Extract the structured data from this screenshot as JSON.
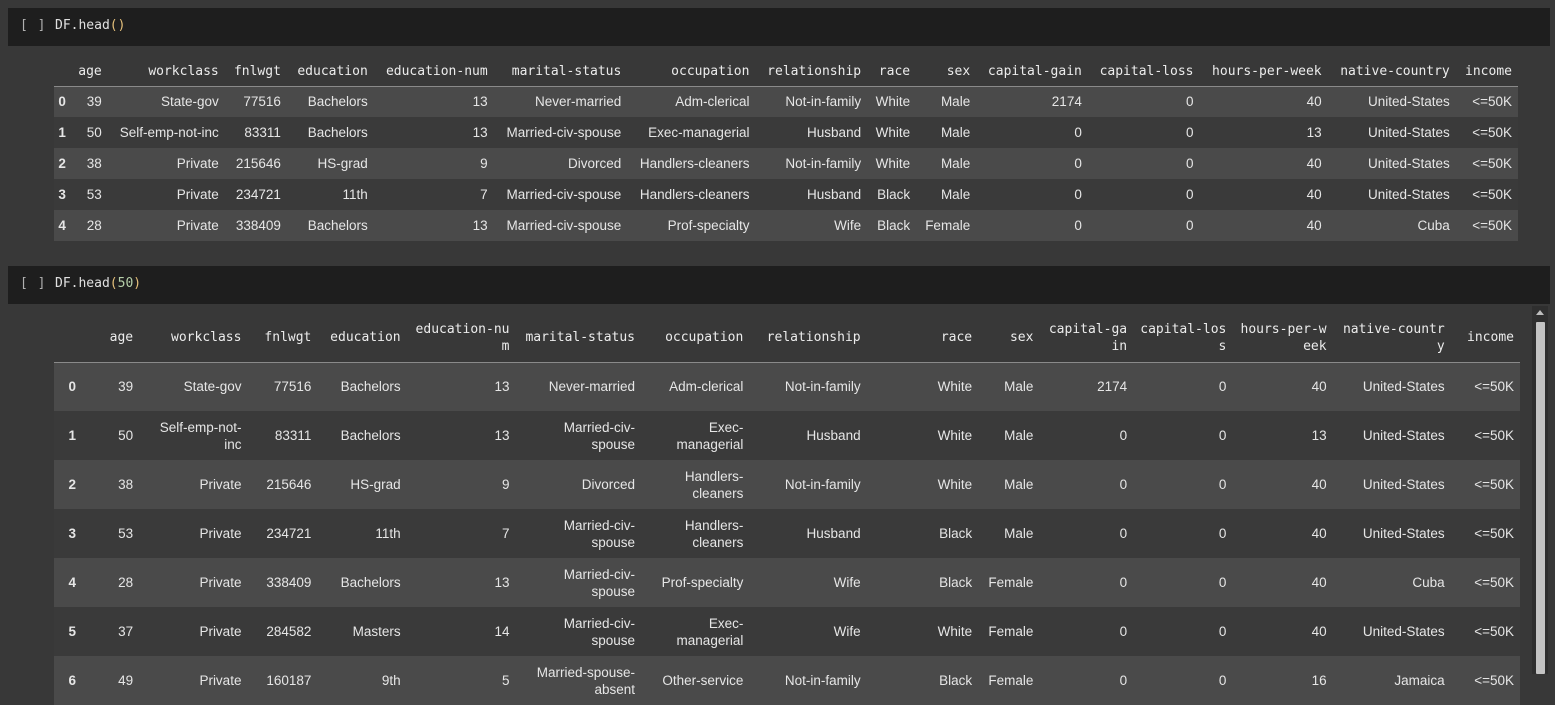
{
  "cells": [
    {
      "run_label": "[ ]",
      "code_prefix": "DF.head",
      "code_open": "(",
      "code_arg": "",
      "code_close": ")"
    },
    {
      "run_label": "[ ]",
      "code_prefix": "DF.head",
      "code_open": "(",
      "code_arg": "50",
      "code_close": ")"
    }
  ],
  "table1": {
    "headers": [
      "",
      "age",
      "workclass",
      "fnlwgt",
      "education",
      "education-num",
      "marital-status",
      "occupation",
      "relationship",
      "race",
      "sex",
      "capital-gain",
      "capital-loss",
      "hours-per-week",
      "native-country",
      "income"
    ],
    "rows": [
      [
        "0",
        "39",
        "State-gov",
        "77516",
        "Bachelors",
        "13",
        "Never-married",
        "Adm-clerical",
        "Not-in-family",
        "White",
        "Male",
        "2174",
        "0",
        "40",
        "United-States",
        "<=50K"
      ],
      [
        "1",
        "50",
        "Self-emp-not-inc",
        "83311",
        "Bachelors",
        "13",
        "Married-civ-spouse",
        "Exec-managerial",
        "Husband",
        "White",
        "Male",
        "0",
        "0",
        "13",
        "United-States",
        "<=50K"
      ],
      [
        "2",
        "38",
        "Private",
        "215646",
        "HS-grad",
        "9",
        "Divorced",
        "Handlers-cleaners",
        "Not-in-family",
        "White",
        "Male",
        "0",
        "0",
        "40",
        "United-States",
        "<=50K"
      ],
      [
        "3",
        "53",
        "Private",
        "234721",
        "11th",
        "7",
        "Married-civ-spouse",
        "Handlers-cleaners",
        "Husband",
        "Black",
        "Male",
        "0",
        "0",
        "40",
        "United-States",
        "<=50K"
      ],
      [
        "4",
        "28",
        "Private",
        "338409",
        "Bachelors",
        "13",
        "Married-civ-spouse",
        "Prof-specialty",
        "Wife",
        "Black",
        "Female",
        "0",
        "0",
        "40",
        "Cuba",
        "<=50K"
      ]
    ]
  },
  "table2": {
    "headers": [
      "",
      "age",
      "workclass",
      "fnlwgt",
      "education",
      "education-num",
      "marital-status",
      "occupation",
      "relationship",
      "race",
      "sex",
      "capital-gain",
      "capital-loss",
      "hours-per-week",
      "native-country",
      "income"
    ],
    "rows": [
      [
        "0",
        "39",
        "State-gov",
        "77516",
        "Bachelors",
        "13",
        "Never-married",
        "Adm-clerical",
        "Not-in-family",
        "White",
        "Male",
        "2174",
        "0",
        "40",
        "United-States",
        "<=50K"
      ],
      [
        "1",
        "50",
        "Self-emp-not-inc",
        "83311",
        "Bachelors",
        "13",
        "Married-civ-spouse",
        "Exec-managerial",
        "Husband",
        "White",
        "Male",
        "0",
        "0",
        "13",
        "United-States",
        "<=50K"
      ],
      [
        "2",
        "38",
        "Private",
        "215646",
        "HS-grad",
        "9",
        "Divorced",
        "Handlers-cleaners",
        "Not-in-family",
        "White",
        "Male",
        "0",
        "0",
        "40",
        "United-States",
        "<=50K"
      ],
      [
        "3",
        "53",
        "Private",
        "234721",
        "11th",
        "7",
        "Married-civ-spouse",
        "Handlers-cleaners",
        "Husband",
        "Black",
        "Male",
        "0",
        "0",
        "40",
        "United-States",
        "<=50K"
      ],
      [
        "4",
        "28",
        "Private",
        "338409",
        "Bachelors",
        "13",
        "Married-civ-spouse",
        "Prof-specialty",
        "Wife",
        "Black",
        "Female",
        "0",
        "0",
        "40",
        "Cuba",
        "<=50K"
      ],
      [
        "5",
        "37",
        "Private",
        "284582",
        "Masters",
        "14",
        "Married-civ-spouse",
        "Exec-managerial",
        "Wife",
        "White",
        "Female",
        "0",
        "0",
        "40",
        "United-States",
        "<=50K"
      ],
      [
        "6",
        "49",
        "Private",
        "160187",
        "9th",
        "5",
        "Married-spouse-absent",
        "Other-service",
        "Not-in-family",
        "Black",
        "Female",
        "0",
        "0",
        "16",
        "Jamaica",
        "<=50K"
      ]
    ]
  },
  "colors": {
    "page_bg": "#383838",
    "code_bg": "#1e1e1e",
    "row_odd": "#4a4a4a",
    "row_even": "#3a3a3a",
    "paren": "#e5c07b",
    "number": "#b5cea8"
  }
}
